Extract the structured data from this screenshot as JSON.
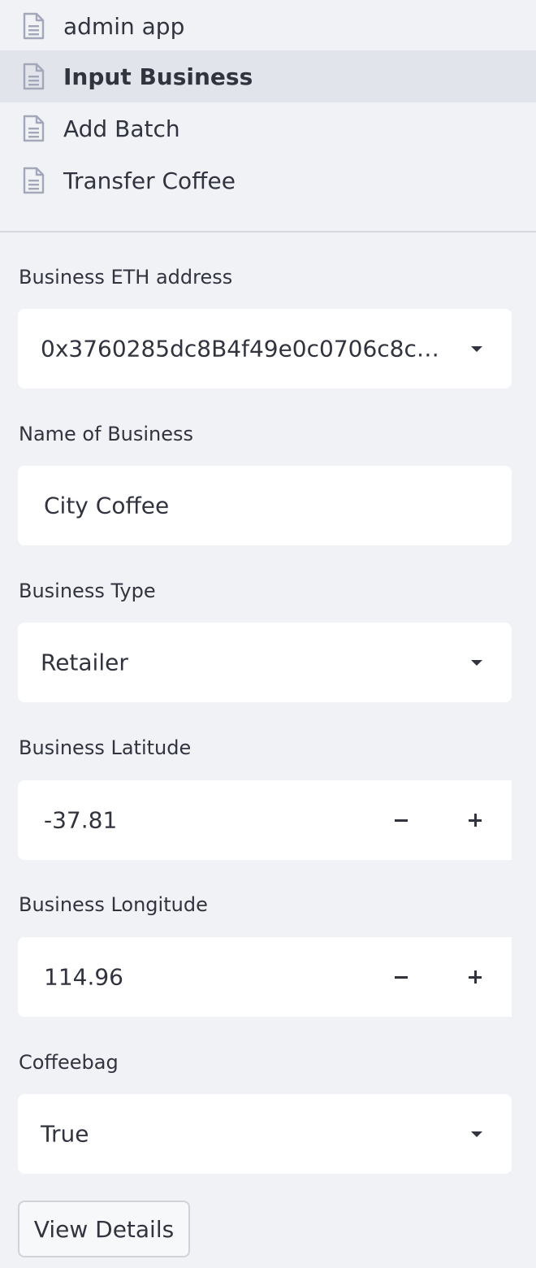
{
  "nav": {
    "items": [
      {
        "label": "admin app",
        "icon": "page-icon",
        "active": false
      },
      {
        "label": "Input Business",
        "icon": "page-icon",
        "active": true
      },
      {
        "label": "Add Batch",
        "icon": "page-icon",
        "active": false
      },
      {
        "label": "Transfer Coffee",
        "icon": "page-icon",
        "active": false
      }
    ]
  },
  "form": {
    "eth_address": {
      "label": "Business ETH address",
      "value": "0x3760285dc8B4f49e0c0706c8cb9e..."
    },
    "business_name": {
      "label": "Name of Business",
      "value": "City Coffee"
    },
    "business_type": {
      "label": "Business Type",
      "value": "Retailer"
    },
    "latitude": {
      "label": "Business Latitude",
      "value": "-37.81"
    },
    "longitude": {
      "label": "Business Longitude",
      "value": "114.96"
    },
    "coffeebag": {
      "label": "Coffeebag",
      "value": "True"
    },
    "submit_label": "View Details"
  },
  "colors": {
    "sidebar_bg": "#f0f2f6",
    "active_item_bg": "#e1e4ea",
    "text": "#31333f",
    "icon": "#a3a8b8"
  }
}
